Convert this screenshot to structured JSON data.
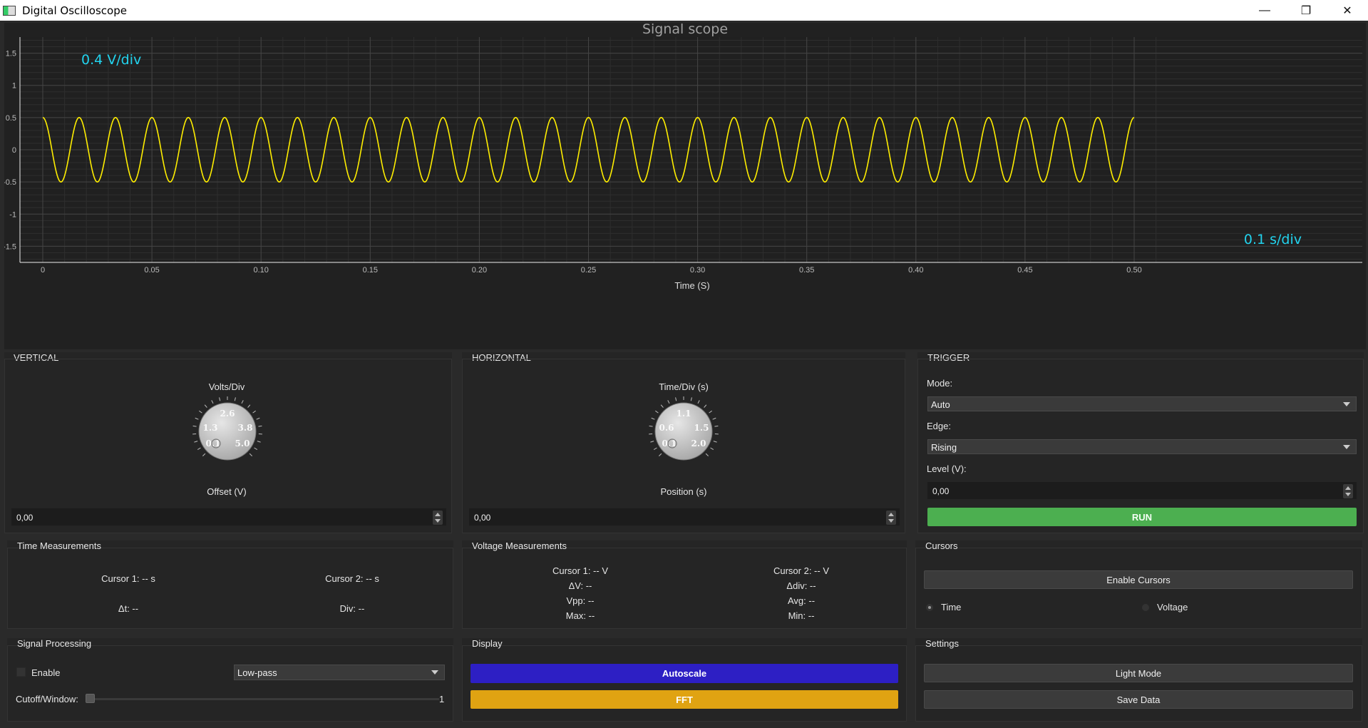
{
  "window": {
    "title": "Digital Oscilloscope",
    "minimize": "—",
    "maximize": "❐",
    "close": "✕"
  },
  "plot": {
    "title": "Signal scope",
    "volts_per_div_label": "0.4 V/div",
    "time_per_div_label": "0.1 s/div",
    "xlabel": "Time (S)",
    "trace_color": "#ffee00",
    "label_color": "#22d3ee"
  },
  "chart_data": {
    "type": "line",
    "title": "Signal scope",
    "xlabel": "Time (S)",
    "ylabel": "",
    "xlim": [
      0,
      0.5
    ],
    "ylim": [
      -1.75,
      1.75
    ],
    "x_ticks": [
      "0",
      "0.05",
      "0.10",
      "0.15",
      "0.20",
      "0.25",
      "0.30",
      "0.35",
      "0.40",
      "0.45",
      "0.50"
    ],
    "y_ticks": [
      "1.5",
      "1",
      "0.5",
      "0",
      "-0.5",
      "-1",
      "-1.5"
    ],
    "grid": true,
    "series": [
      {
        "waveform": "cosine",
        "amplitude": 0.5,
        "frequency_hz": 60,
        "t_start": 0,
        "t_end": 0.5
      }
    ]
  },
  "vertical": {
    "title": "VERTICAL",
    "knob_label": "Volts/Div",
    "knob_scale": [
      "2.6",
      "1.3",
      "3.8",
      "0.1",
      "5.0"
    ],
    "offset_label": "Offset (V)",
    "offset_value": "0,00"
  },
  "horizontal": {
    "title": "HORIZONTAL",
    "knob_label": "Time/Div (s)",
    "knob_scale": [
      "1.1",
      "0.6",
      "1.5",
      "0.1",
      "2.0"
    ],
    "position_label": "Position (s)",
    "position_value": "0,00"
  },
  "trigger": {
    "title": "TRIGGER",
    "mode_label": "Mode:",
    "mode_value": "Auto",
    "edge_label": "Edge:",
    "edge_value": "Rising",
    "level_label": "Level (V):",
    "level_value": "0,00",
    "run_label": "RUN"
  },
  "time_measurements": {
    "title": "Time Measurements",
    "cursor1": "Cursor 1: -- s",
    "cursor2": "Cursor 2: -- s",
    "dt": "Δt: --",
    "div": "Div: --"
  },
  "voltage_measurements": {
    "title": "Voltage Measurements",
    "cursor1": "Cursor 1: -- V",
    "cursor2": "Cursor 2: -- V",
    "dv": "ΔV: --",
    "ddiv": "Δdiv: --",
    "vpp": "Vpp: --",
    "avg": "Avg: --",
    "max": "Max: --",
    "min": "Min: --"
  },
  "cursors": {
    "title": "Cursors",
    "enable_label": "Enable Cursors",
    "time_label": "Time",
    "voltage_label": "Voltage"
  },
  "signal_processing": {
    "title": "Signal Processing",
    "enable_label": "Enable",
    "filter_value": "Low-pass",
    "cutoff_label": "Cutoff/Window:",
    "cutoff_value": "1"
  },
  "display": {
    "title": "Display",
    "autoscale_label": "Autoscale",
    "fft_label": "FFT"
  },
  "settings": {
    "title": "Settings",
    "light_mode_label": "Light Mode",
    "save_label": "Save Data"
  }
}
